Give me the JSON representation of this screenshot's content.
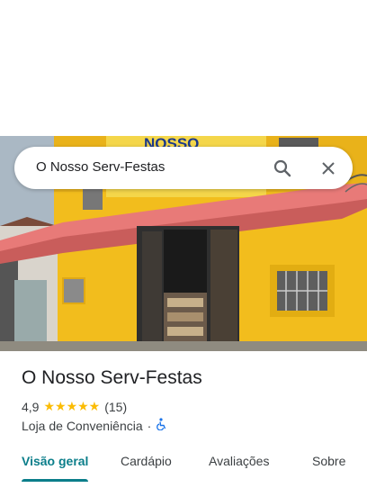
{
  "search": {
    "query": "O Nosso Serv-Festas",
    "search_icon": "search-icon",
    "close_icon": "close-icon"
  },
  "photo": {
    "sign_text": "NOSSO"
  },
  "place": {
    "name": "O Nosso Serv-Festas",
    "rating": "4,9",
    "stars": "★★★★★",
    "review_count": "(15)",
    "category": "Loja de Conveniência",
    "separator": "·",
    "accessibility_icon": "wheelchair-icon"
  },
  "tabs": [
    {
      "label": "Visão geral",
      "active": true
    },
    {
      "label": "Cardápio",
      "active": false
    },
    {
      "label": "Avaliações",
      "active": false
    },
    {
      "label": "Sobre",
      "active": false
    }
  ],
  "colors": {
    "accent": "#0b7e8a",
    "star": "#fbbc04",
    "wall": "#f2bd1d",
    "awning": "#e87a78"
  }
}
